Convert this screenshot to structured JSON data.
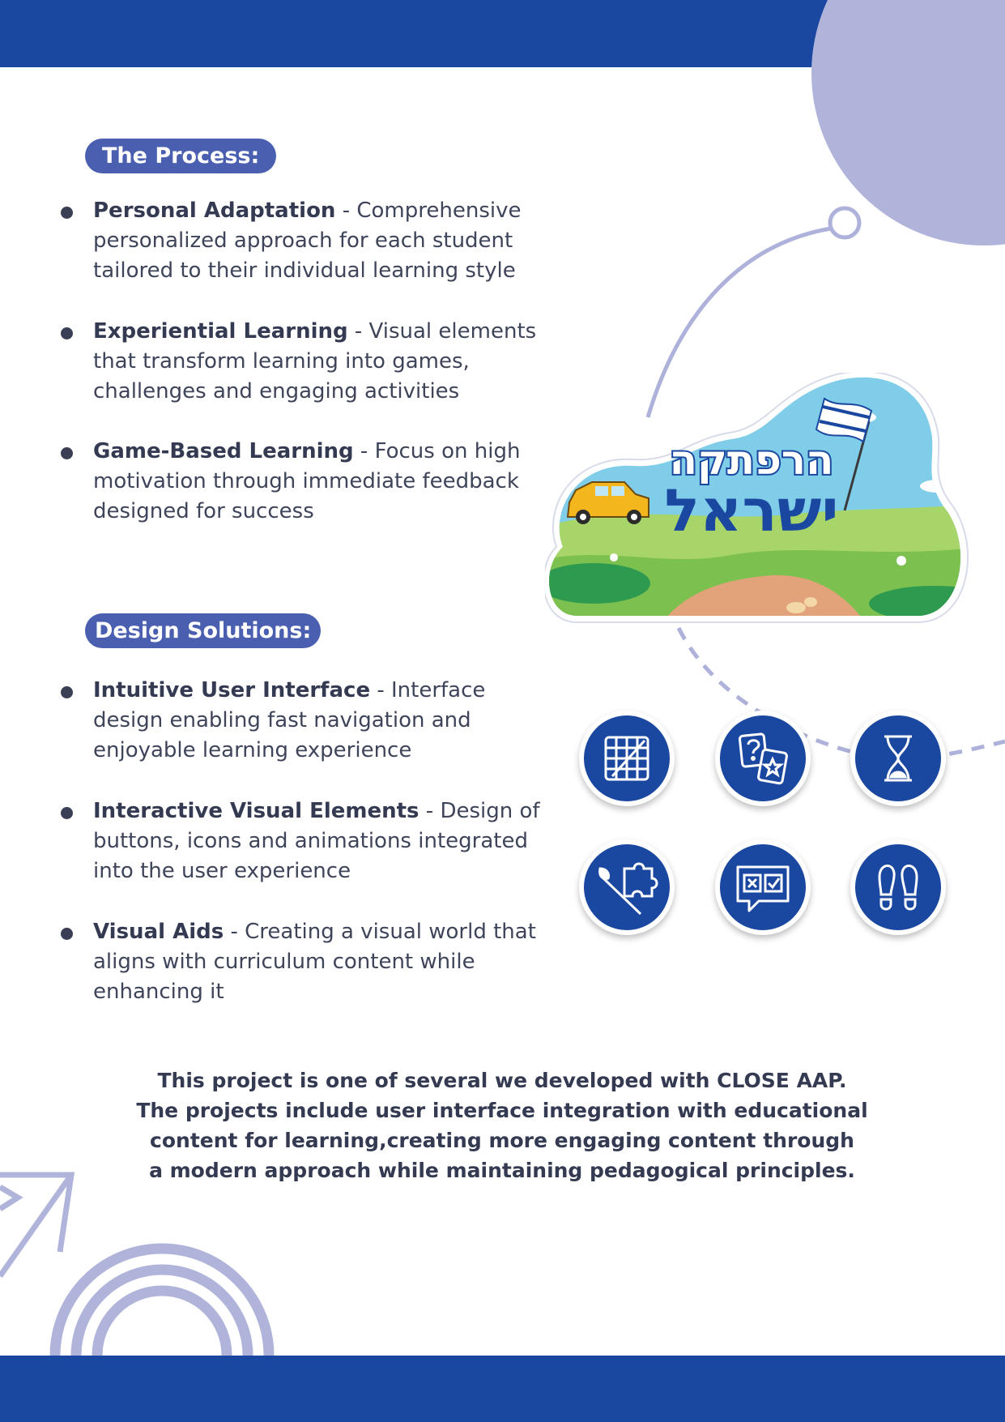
{
  "colors": {
    "brand_blue": "#1a47a0",
    "pill_blue": "#4a5fb0",
    "lavender": "#b0b4da",
    "text": "#3e4459"
  },
  "process": {
    "heading": "The Process:",
    "items": [
      {
        "title": "Personal Adaptation",
        "desc": " - Comprehensive personalized approach for each student tailored to their individual learning style"
      },
      {
        "title": "Experiential Learning",
        "desc": " - Visual elements that transform learning into games, challenges and engaging activities"
      },
      {
        "title": "Game-Based Learning",
        "desc": " - Focus on high motivation through immediate feedback designed for success"
      }
    ]
  },
  "design": {
    "heading": "Design Solutions:",
    "items": [
      {
        "title": "Intuitive User Interface",
        "desc": " - Interface design enabling fast navigation and enjoyable learning experience"
      },
      {
        "title": "Interactive Visual Elements",
        "desc": " - Design of buttons, icons and animations integrated into the user experience"
      },
      {
        "title": "Visual Aids",
        "desc": " - Creating a visual world that aligns with curriculum content while enhancing it"
      }
    ]
  },
  "badge": {
    "line1": "הרפתקה",
    "line2": "ישראל"
  },
  "icons": [
    "word-grid-icon",
    "question-cards-icon",
    "hourglass-icon",
    "puzzle-brush-icon",
    "quiz-bubble-icon",
    "footprints-icon"
  ],
  "footer": {
    "line1": "This project is one of several we developed with CLOSE AAP.",
    "line2": "The projects include user interface integration with educational",
    "line3": "content for learning,creating more engaging content through",
    "line4": "a modern approach while maintaining pedagogical principles."
  }
}
